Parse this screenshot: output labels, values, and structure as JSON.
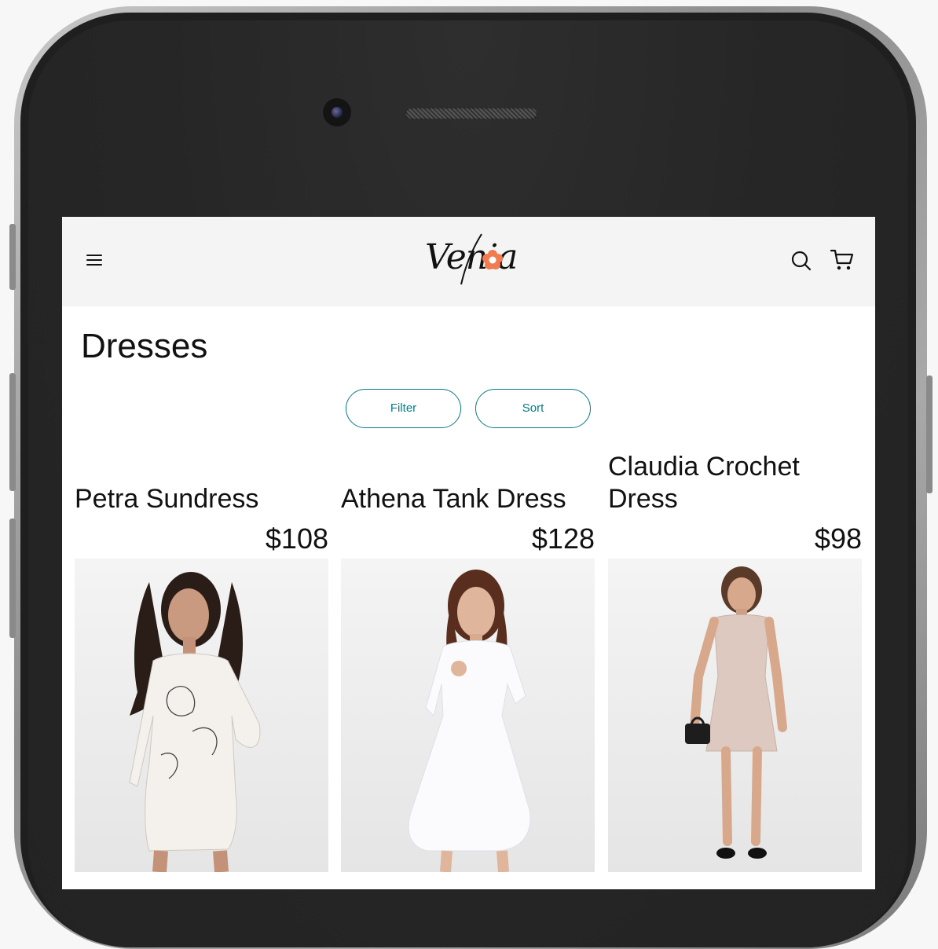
{
  "header": {
    "logo_text": "Venia",
    "menu_icon": "menu-icon",
    "search_icon": "search-icon",
    "cart_icon": "cart-icon",
    "logo_accent_color": "#f27b4f"
  },
  "page": {
    "title": "Dresses"
  },
  "controls": {
    "filter_label": "Filter",
    "sort_label": "Sort",
    "accent_color": "#0b7b86"
  },
  "products": [
    {
      "name": "Petra Sundress",
      "price": "$108"
    },
    {
      "name": "Athena Tank Dress",
      "price": "$128"
    },
    {
      "name": "Claudia Crochet Dress",
      "price": "$98"
    }
  ]
}
